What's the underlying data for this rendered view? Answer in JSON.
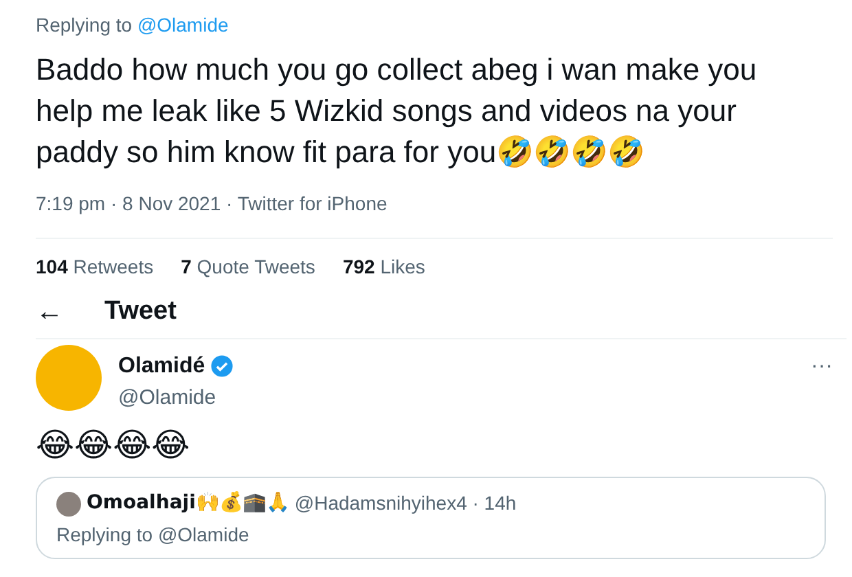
{
  "reply_context": {
    "label": "Replying to",
    "handle": "@Olamide"
  },
  "tweet_text": "Baddo how much you go collect abeg i wan make you help me leak like 5 Wizkid songs and videos na your paddy so him know fit para for you🤣🤣🤣🤣",
  "meta": "7:19 pm · 8 Nov 2021 · Twitter for iPhone",
  "stats": [
    {
      "count": "104",
      "label": "Retweets"
    },
    {
      "count": "7",
      "label": "Quote Tweets"
    },
    {
      "count": "792",
      "label": "Likes"
    }
  ],
  "header": {
    "back": "←",
    "title": "Tweet"
  },
  "author": {
    "name": "Olamidé",
    "verified": true,
    "handle": "@Olamide",
    "more": "···"
  },
  "author_tweet": "😂😂😂😂",
  "quoted": {
    "name": "Omoalhaji🙌💰🕋🙏",
    "handle_age": "@Hadamsnihyihex4 · 14h",
    "reply_label": "Replying to",
    "reply_handle": "@Olamide"
  }
}
